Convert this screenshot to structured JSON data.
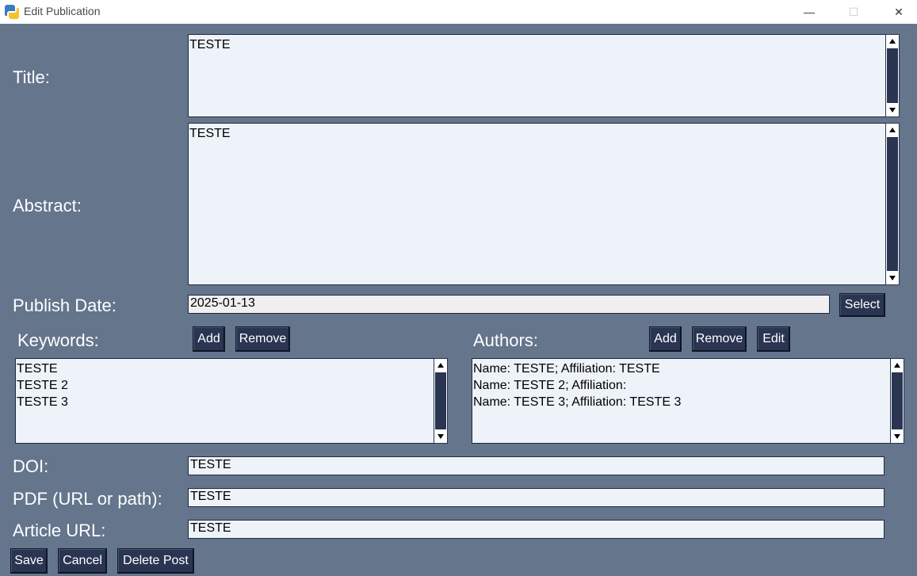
{
  "window": {
    "title": "Edit Publication",
    "minimize": "—",
    "maximize": "☐",
    "close": "✕"
  },
  "labels": {
    "title": "Title:",
    "abstract": "Abstract:",
    "publish_date": "Publish Date:",
    "keywords": "Keywords:",
    "authors": "Authors:",
    "doi": "DOI:",
    "pdf": "PDF (URL or path):",
    "article_url": "Article URL:"
  },
  "fields": {
    "title": "TESTE",
    "abstract": "TESTE",
    "publish_date": "2025-01-13",
    "doi": "TESTE",
    "pdf": "TESTE",
    "article_url": "TESTE"
  },
  "keywords": {
    "items": [
      "TESTE",
      "TESTE 2",
      "TESTE 3"
    ],
    "add_label": "Add",
    "remove_label": "Remove"
  },
  "authors": {
    "items": [
      "Name: TESTE; Affiliation: TESTE",
      "Name: TESTE 2; Affiliation:",
      "Name: TESTE 3; Affiliation: TESTE 3"
    ],
    "add_label": "Add",
    "remove_label": "Remove",
    "edit_label": "Edit"
  },
  "buttons": {
    "select": "Select",
    "save": "Save",
    "cancel": "Cancel",
    "delete": "Delete Post"
  },
  "icons": {
    "app": "python-logo-icon",
    "scroll_up": "triangle-up-icon",
    "scroll_down": "triangle-down-icon"
  },
  "colors": {
    "background": "#64758c",
    "button": "#2a3552",
    "field": "#eef2f9",
    "scrollbar_trough": "#2a3552"
  }
}
